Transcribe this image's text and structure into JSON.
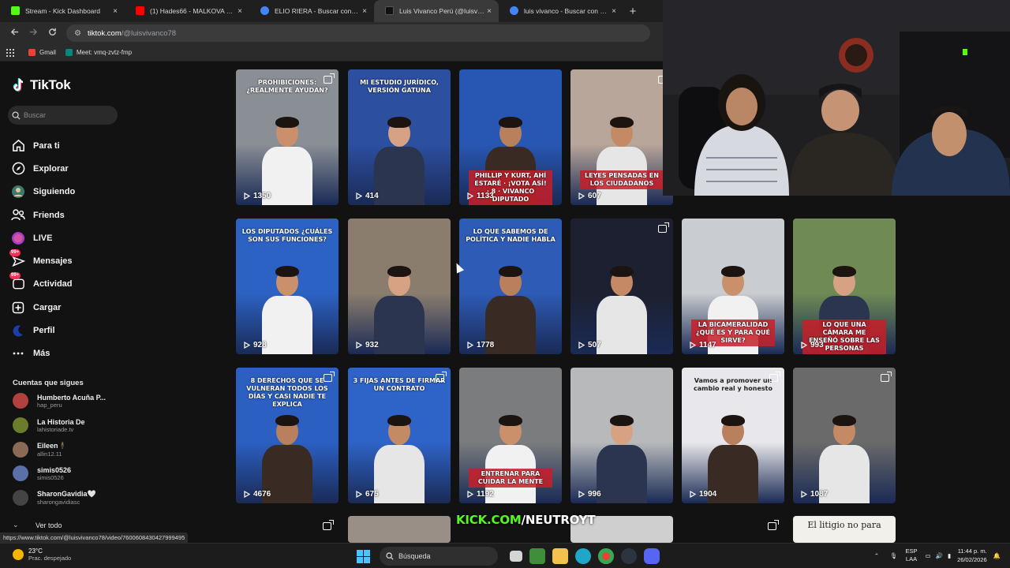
{
  "browser": {
    "tabs": [
      {
        "title": "Stream - Kick Dashboard",
        "color": "#53fc18"
      },
      {
        "title": "(1) Hades66 - MALKOVA 🔴 EL",
        "color": "#ff0000"
      },
      {
        "title": "ELIO RIERA - Buscar con Googl",
        "color": "#4285f4"
      },
      {
        "title": "Luis Vivanco Perú (@luisvivanc",
        "color": "#111111"
      },
      {
        "title": "luis vivanco - Buscar con Goog",
        "color": "#4285f4"
      }
    ],
    "close_glyph": "×",
    "newtab_glyph": "+",
    "url_host": "tiktok.com",
    "url_path": "/@luisvivanco78",
    "bookmarks": [
      {
        "label": "Gmail",
        "color": "#ea4335"
      },
      {
        "label": "Meet: vmq-zvtz-fmp",
        "color": "#00897b"
      }
    ]
  },
  "sidebar": {
    "logo": "TikTok",
    "search_placeholder": "Buscar",
    "nav": [
      {
        "label": "Para ti",
        "icon": "home-icon"
      },
      {
        "label": "Explorar",
        "icon": "compass-icon"
      },
      {
        "label": "Siguiendo",
        "icon": "following-icon"
      },
      {
        "label": "Friends",
        "icon": "friends-icon"
      },
      {
        "label": "LIVE",
        "icon": "live-icon"
      },
      {
        "label": "Mensajes",
        "icon": "messages-icon",
        "badge": "99+"
      },
      {
        "label": "Actividad",
        "icon": "activity-icon",
        "badge": "99+"
      },
      {
        "label": "Cargar",
        "icon": "upload-icon"
      },
      {
        "label": "Perfil",
        "icon": "profile-icon"
      },
      {
        "label": "Más",
        "icon": "more-icon"
      }
    ],
    "following_header": "Cuentas que sigues",
    "accounts": [
      {
        "name": "Humberto Acuña P...",
        "handle": "hap_peru",
        "color": "#b0413e"
      },
      {
        "name": "La Historia De",
        "handle": "lahistoriade.tv",
        "color": "#6b7c2a"
      },
      {
        "name": "Eileen🕴️",
        "handle": "allin12.11",
        "color": "#8a6a55"
      },
      {
        "name": "simis0526",
        "handle": "simis0526",
        "color": "#5b6fa8"
      },
      {
        "name": "SharonGavidia🤍",
        "handle": "sharongavidiasc",
        "color": "#444444"
      }
    ],
    "see_all": "Ver todo"
  },
  "videos": [
    {
      "views": "1350",
      "caption": "PROHIBICIONES: ¿REALMENTE AYUDAN?",
      "pinned": true,
      "bg": "#8a8f96"
    },
    {
      "views": "414",
      "caption": "MI ESTUDIO JURÍDICO, VERSIÓN GATUNA",
      "pinned": false,
      "bg": "#2c4fa0"
    },
    {
      "views": "1133",
      "caption": "PHILLIP Y KURT, AHÍ ESTARÉ · ¡VOTA ASÍ! · 8 · VIVANCO DIPUTADO",
      "pinned": false,
      "bg": "#2857b3"
    },
    {
      "views": "607",
      "caption": "LEYES PENSADAS EN LOS CIUDADANOS",
      "pinned": true,
      "bg": "#b9a69a"
    },
    {
      "views": "928",
      "caption": "LOS DIPUTADOS ¿CUÁLES SON SUS FUNCIONES?",
      "pinned": false,
      "bg": "#2c62c4"
    },
    {
      "views": "932",
      "caption": "",
      "pinned": false,
      "bg": "#8b7d6e"
    },
    {
      "views": "1778",
      "caption": "LO QUE SABEMOS DE POLÍTICA Y NADIE HABLA",
      "pinned": false,
      "bg": "#2e5bb5"
    },
    {
      "views": "507",
      "caption": "",
      "pinned": true,
      "bg": "#1d2030"
    },
    {
      "views": "1147",
      "caption": "LA BICAMERALIDAD ¿QUÉ ES Y PARA QUÉ SIRVE?",
      "pinned": false,
      "bg": "#c9ccd0"
    },
    {
      "views": "993",
      "caption": "LO QUE UNA CÁMARA ME ENSEÑÓ SOBRE LAS PERSONAS",
      "pinned": false,
      "bg": "#6f8a55"
    },
    {
      "views": "4676",
      "caption": "8 DERECHOS QUE SE VULNERAN TODOS LOS DÍAS Y CASI NADIE TE EXPLICA",
      "pinned": true,
      "bg": "#2b5fc2"
    },
    {
      "views": "675",
      "caption": "3 FIJAS ANTES DE FIRMAR UN CONTRATO",
      "pinned": true,
      "bg": "#2e63c7"
    },
    {
      "views": "1192",
      "caption": "ENTRENAR PARA CUIDAR LA MENTE",
      "pinned": false,
      "bg": "#7a7c7e"
    },
    {
      "views": "996",
      "caption": "",
      "pinned": false,
      "bg": "#b7b9bb"
    },
    {
      "views": "1904",
      "caption": "Vamos a promover un cambio real y honesto",
      "pinned": true,
      "bg": "#e8e8ec"
    },
    {
      "views": "1087",
      "caption": "",
      "pinned": true,
      "bg": "#6a6a6a"
    }
  ],
  "row4": {
    "caption": "El litigio no para"
  },
  "status_url": "https://www.tiktok.com/@luisvivanco78/video/7600608430427999495",
  "taskbar": {
    "temp": "23°C",
    "weather": "Prac. despejado",
    "search": "Búsqueda",
    "lang1": "ESP",
    "lang2": "LAA",
    "time": "11:44 p. m.",
    "date": "26/02/2026"
  },
  "overlay": {
    "brand": "KICK.COM",
    "channel": "/NEUTROYT"
  }
}
